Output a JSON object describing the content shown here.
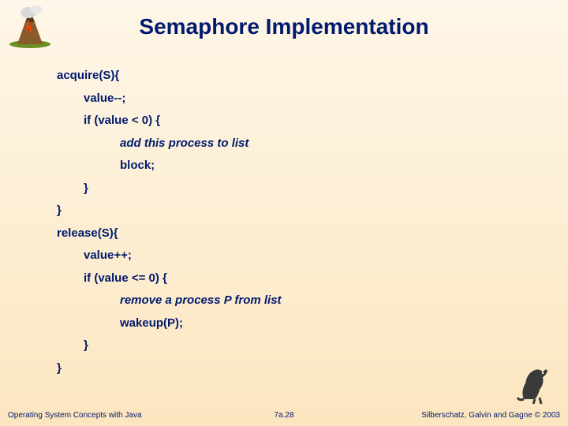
{
  "title": "Semaphore Implementation",
  "code": {
    "l0": "acquire(S){",
    "l1": "value--;",
    "l2": "if (value < 0) {",
    "l3": "add this process to list",
    "l4": "block;",
    "l5": "}",
    "l6": "}",
    "l7": "release(S){",
    "l8": "value++;",
    "l9": "if (value <= 0) {",
    "l10": "remove a process P from list",
    "l11": "wakeup(P);",
    "l12": "}",
    "l13": "}"
  },
  "footer": {
    "left": "Operating System Concepts with Java",
    "center": "7a.28",
    "right": "Silberschatz, Galvin and Gagne © 2003"
  },
  "icons": {
    "volcano": "volcano-icon",
    "dino": "dinosaur-icon"
  }
}
